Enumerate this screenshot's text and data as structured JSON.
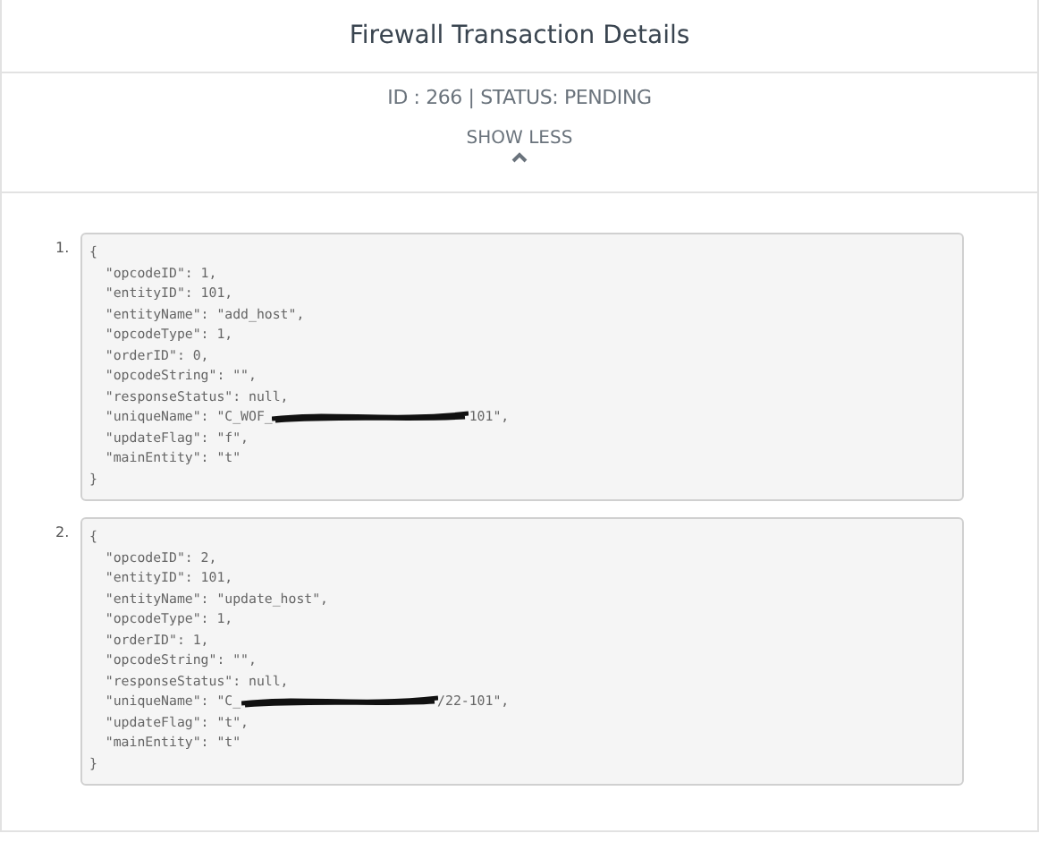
{
  "title": "Firewall Transaction Details",
  "summary": "ID : 266 | STATUS: PENDING",
  "toggle": {
    "label": "SHOW LESS",
    "expanded": true
  },
  "entries": [
    {
      "number": "1.",
      "lines": [
        {
          "kind": "text",
          "text": "{"
        },
        {
          "kind": "text",
          "text": "  \"opcodeID\": 1,"
        },
        {
          "kind": "text",
          "text": "  \"entityID\": 101,"
        },
        {
          "kind": "text",
          "text": "  \"entityName\": \"add_host\","
        },
        {
          "kind": "text",
          "text": "  \"opcodeType\": 1,"
        },
        {
          "kind": "text",
          "text": "  \"orderID\": 0,"
        },
        {
          "kind": "text",
          "text": "  \"opcodeString\": \"\","
        },
        {
          "kind": "text",
          "text": "  \"responseStatus\": null,"
        },
        {
          "kind": "redacted",
          "before": "  \"uniqueName\": \"C_WOF_",
          "after": "101\","
        },
        {
          "kind": "text",
          "text": "  \"updateFlag\": \"f\","
        },
        {
          "kind": "text",
          "text": "  \"mainEntity\": \"t\""
        },
        {
          "kind": "text",
          "text": "}"
        }
      ]
    },
    {
      "number": "2.",
      "lines": [
        {
          "kind": "text",
          "text": "{"
        },
        {
          "kind": "text",
          "text": "  \"opcodeID\": 2,"
        },
        {
          "kind": "text",
          "text": "  \"entityID\": 101,"
        },
        {
          "kind": "text",
          "text": "  \"entityName\": \"update_host\","
        },
        {
          "kind": "text",
          "text": "  \"opcodeType\": 1,"
        },
        {
          "kind": "text",
          "text": "  \"orderID\": 1,"
        },
        {
          "kind": "text",
          "text": "  \"opcodeString\": \"\","
        },
        {
          "kind": "text",
          "text": "  \"responseStatus\": null,"
        },
        {
          "kind": "redacted",
          "before": "  \"uniqueName\": \"C_",
          "after": "/22-101\","
        },
        {
          "kind": "text",
          "text": "  \"updateFlag\": \"t\","
        },
        {
          "kind": "text",
          "text": "  \"mainEntity\": \"t\""
        },
        {
          "kind": "text",
          "text": "}"
        }
      ]
    }
  ]
}
